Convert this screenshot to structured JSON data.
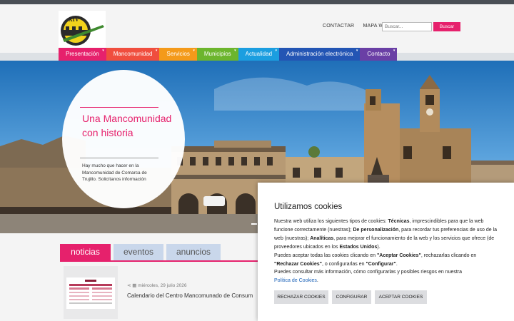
{
  "header": {
    "logo_text": "XIV",
    "links": [
      "CONTACTAR",
      "MAPA WEB"
    ],
    "search_placeholder": "Buscar...",
    "search_button": "Buscar"
  },
  "nav": {
    "items": [
      {
        "label": "Presentación",
        "color": "#e6216c"
      },
      {
        "label": "Mancomunidad",
        "color": "#f04e3e"
      },
      {
        "label": "Servicios",
        "color": "#f49a1a"
      },
      {
        "label": "Municipios",
        "color": "#6cb52d"
      },
      {
        "label": "Actualidad",
        "color": "#1b9ee0"
      },
      {
        "label": "Administración electrónica",
        "color": "#2355b4"
      },
      {
        "label": "Contacto",
        "color": "#6a3fa5"
      }
    ]
  },
  "hero": {
    "title": "Una Mancomunidad con historia",
    "text": "Hay mucho que hacer en la Mancomunidad de Comarca de Trujillo. Solicítanos información"
  },
  "tabs": [
    "noticias",
    "eventos",
    "anuncios"
  ],
  "news": {
    "date": "miércoles, 29 julio 2026",
    "title": "Calendario del Centro Mancomunado de Consum"
  },
  "cookies": {
    "title": "Utilizamos cookies",
    "p1_a": "Nuestra web utiliza los siguientes tipos de cookies: ",
    "p1_b": "Técnicas",
    "p1_c": ", imprescindibles para que la web funcione correctamente (nuestras); ",
    "p1_d": "De personalización",
    "p1_e": ", para recordar tus preferencias de uso de la web (nuestras); ",
    "p1_f": "Analíticas",
    "p1_g": ", para mejorar el funcionamiento de la web y los servicios que ofrece (de proveedores ubicados en los ",
    "p1_h": "Estados Unidos",
    "p1_i": ").",
    "p2_a": "Puedes aceptar todas las cookies clicando en ",
    "p2_b": "\"Aceptar Cookies\"",
    "p2_c": ", rechazarlas clicando en ",
    "p2_d": "\"Rechazar Cookies\"",
    "p2_e": ", o configurarlas en ",
    "p2_f": "\"Configurar\"",
    "p2_g": ".",
    "p3": "Puedes consultar más información, cómo configurarlas y posibles riesgos en nuestra",
    "link": "Política de Cookies",
    "link_end": ".",
    "buttons": {
      "reject": "RECHAZAR COOKIES",
      "configure": "CONFIGURAR",
      "accept": "ACEPTAR COOKIES"
    }
  },
  "colors": {
    "accent": "#e6216c",
    "tab_inactive": "#c9d7eb",
    "link": "#1b62b8"
  }
}
